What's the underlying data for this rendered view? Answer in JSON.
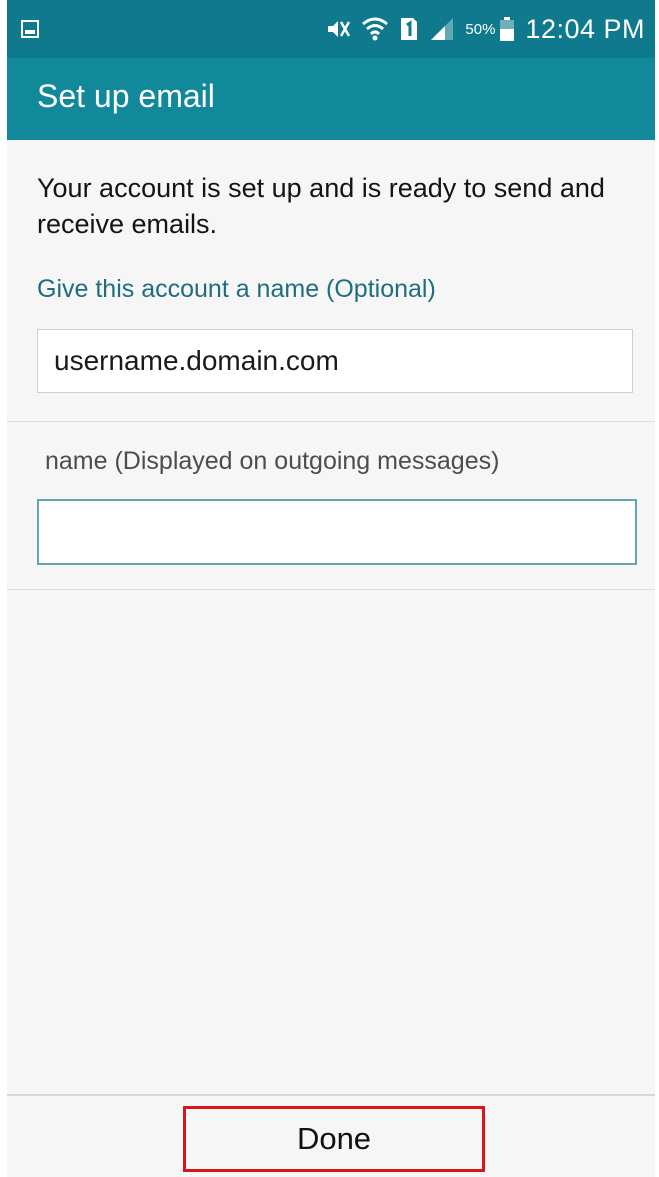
{
  "status_bar": {
    "left_icon": "gallery-icon",
    "icons": [
      "mute-icon",
      "wifi-icon",
      "sim-1-icon",
      "signal-icon",
      "battery-icon"
    ],
    "battery": "50%",
    "time": "12:04 PM"
  },
  "app_bar": {
    "title": "Set up email"
  },
  "main": {
    "message": "Your account is set up and is ready to send and receive emails.",
    "account_name_label": "Give this account a name (Optional)",
    "account_name_value": "username.domain.com",
    "display_name_label": "name (Displayed on outgoing messages)",
    "display_name_value": ""
  },
  "bottom_bar": {
    "done_label": "Done"
  },
  "colors": {
    "status_bar": "#0f7a8e",
    "app_bar": "#12889b",
    "label_accent": "#1f6d7f",
    "focused_input_border": "#5fa7b5",
    "highlight_box": "#d9151b"
  }
}
